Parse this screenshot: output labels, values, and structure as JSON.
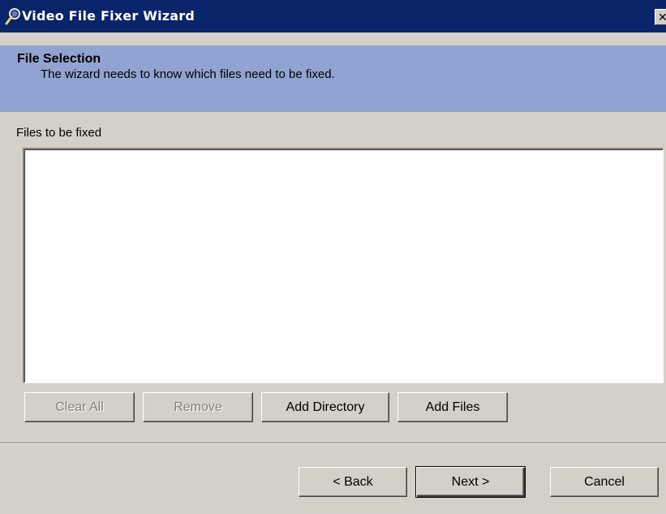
{
  "window": {
    "title": "Video File Fixer Wizard",
    "icon": "wrench-magnifier-icon",
    "close_glyph": "✕"
  },
  "header": {
    "title": "File Selection",
    "description": "The wizard needs to know which files need to be fixed."
  },
  "files": {
    "label": "Files to be fixed",
    "items": []
  },
  "file_buttons": {
    "clear_all": "Clear All",
    "remove": "Remove",
    "add_directory": "Add Directory",
    "add_files": "Add Files"
  },
  "nav_buttons": {
    "back": "< Back",
    "next": "Next >",
    "cancel": "Cancel"
  },
  "colors": {
    "titlebar": "#0a246a",
    "header_band": "#91a3d1",
    "window_bg": "#d4d0c8"
  }
}
